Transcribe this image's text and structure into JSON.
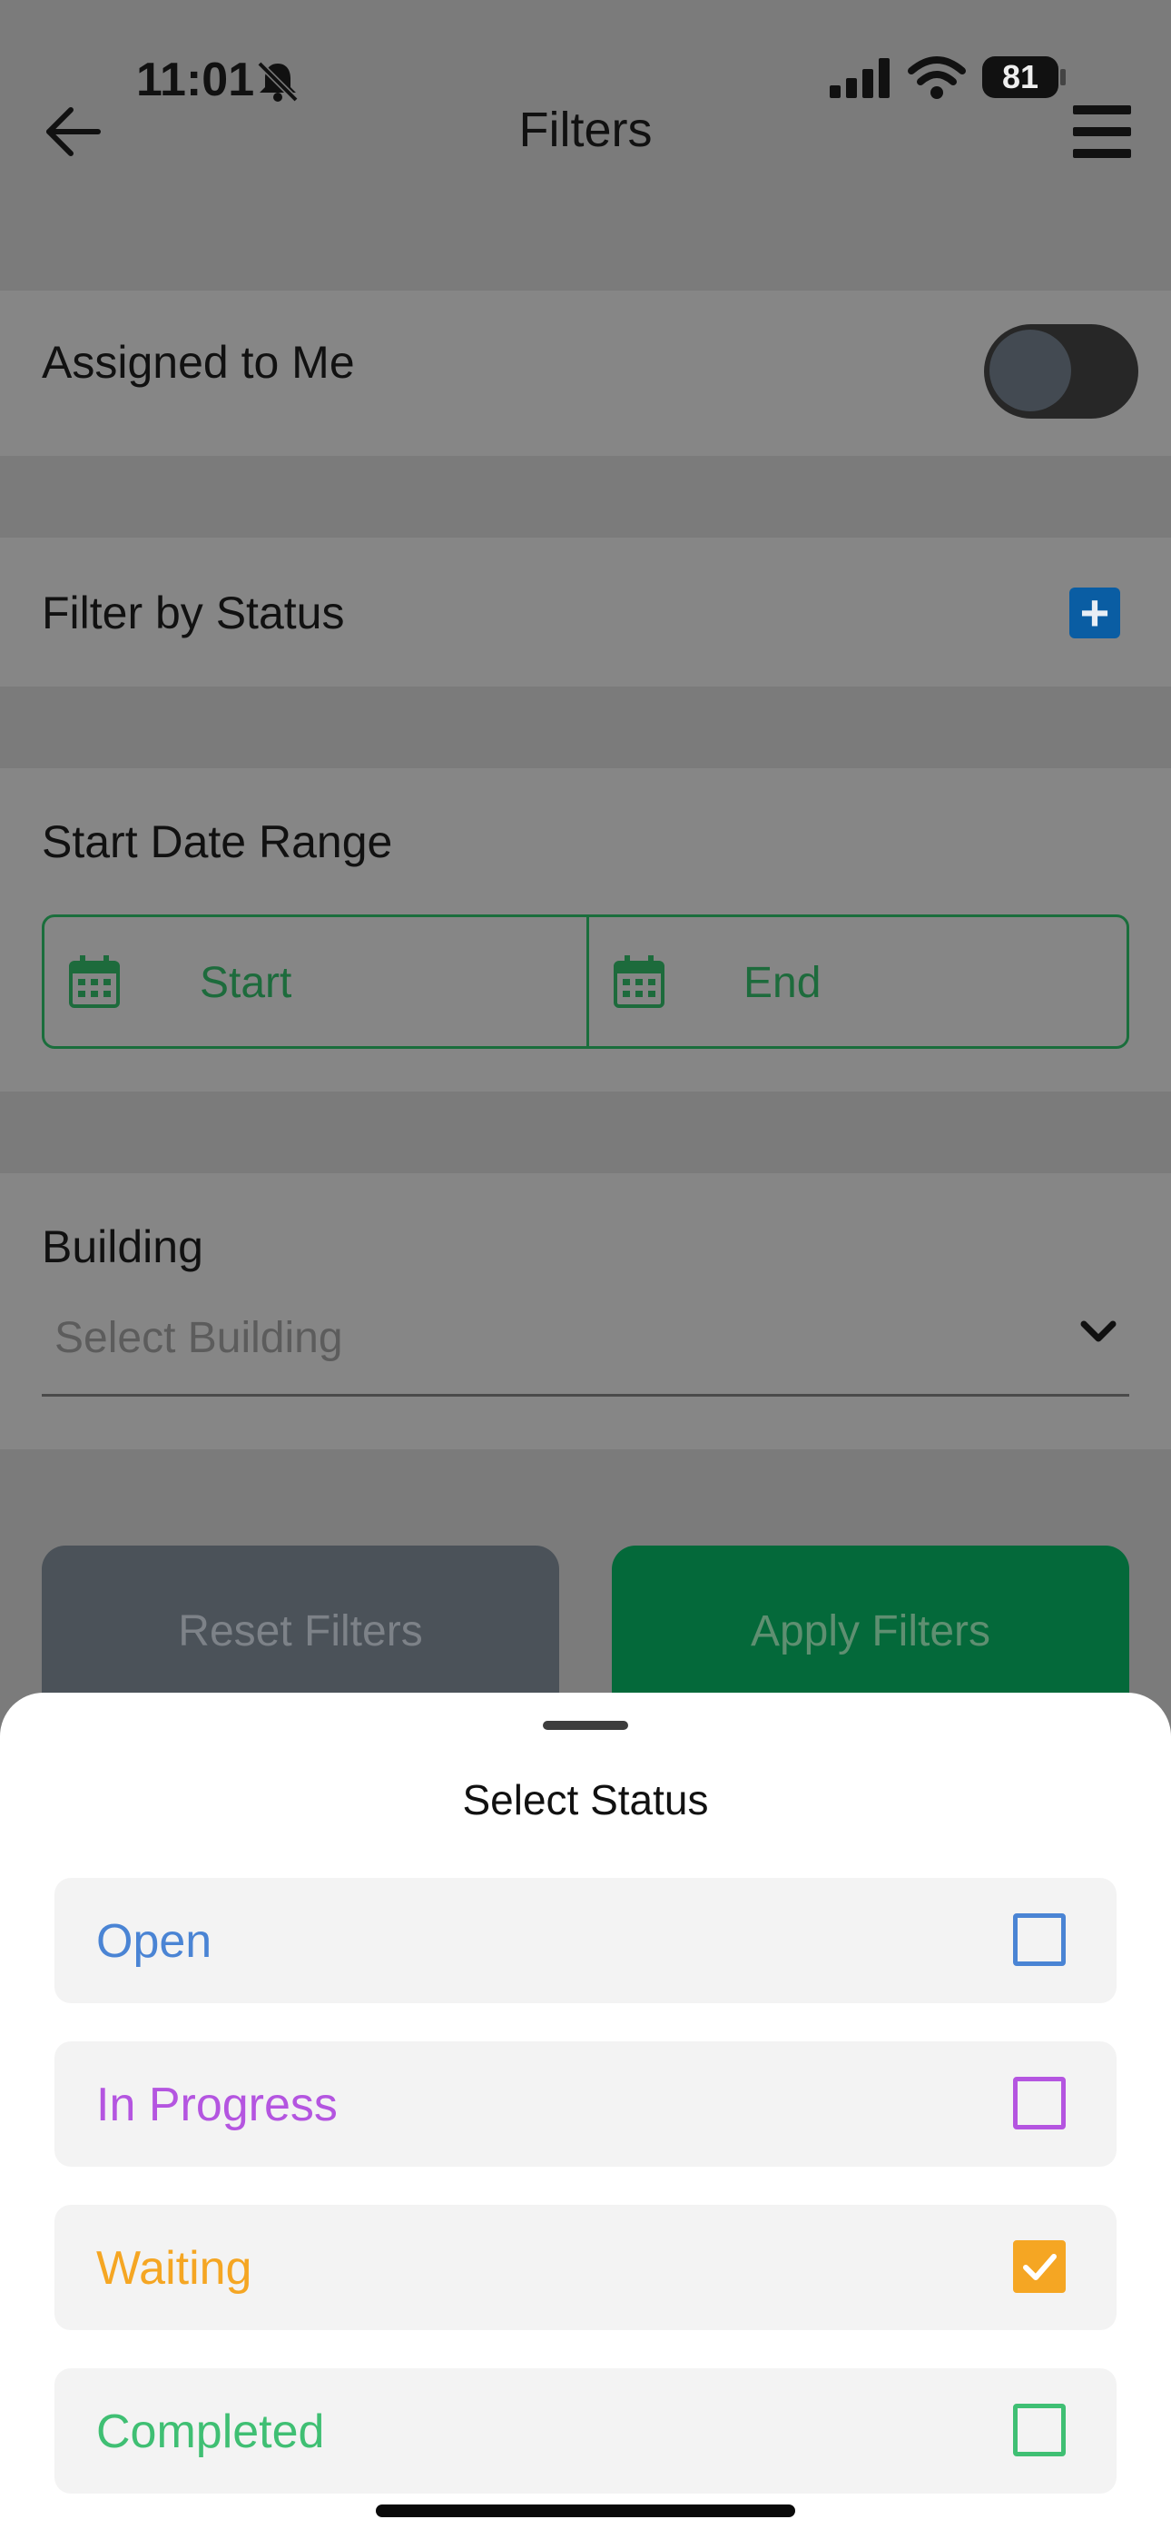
{
  "status_bar": {
    "time": "11:01",
    "battery": "81"
  },
  "header": {
    "title": "Filters"
  },
  "assigned": {
    "label": "Assigned to Me",
    "on": false
  },
  "status_filter": {
    "label": "Filter by Status"
  },
  "date_range": {
    "label": "Start Date Range",
    "start": "Start",
    "end": "End"
  },
  "building": {
    "label": "Building",
    "placeholder": "Select Building"
  },
  "buttons": {
    "reset": "Reset Filters",
    "apply": "Apply Filters"
  },
  "sheet": {
    "title": "Select Status",
    "options": [
      {
        "label": "Open",
        "color": "#4a84d4",
        "checked": false
      },
      {
        "label": "In Progress",
        "color": "#b455e0",
        "checked": false
      },
      {
        "label": "Waiting",
        "color": "#f5a623",
        "checked": true
      },
      {
        "label": "Completed",
        "color": "#3fbf73",
        "checked": false
      }
    ]
  }
}
